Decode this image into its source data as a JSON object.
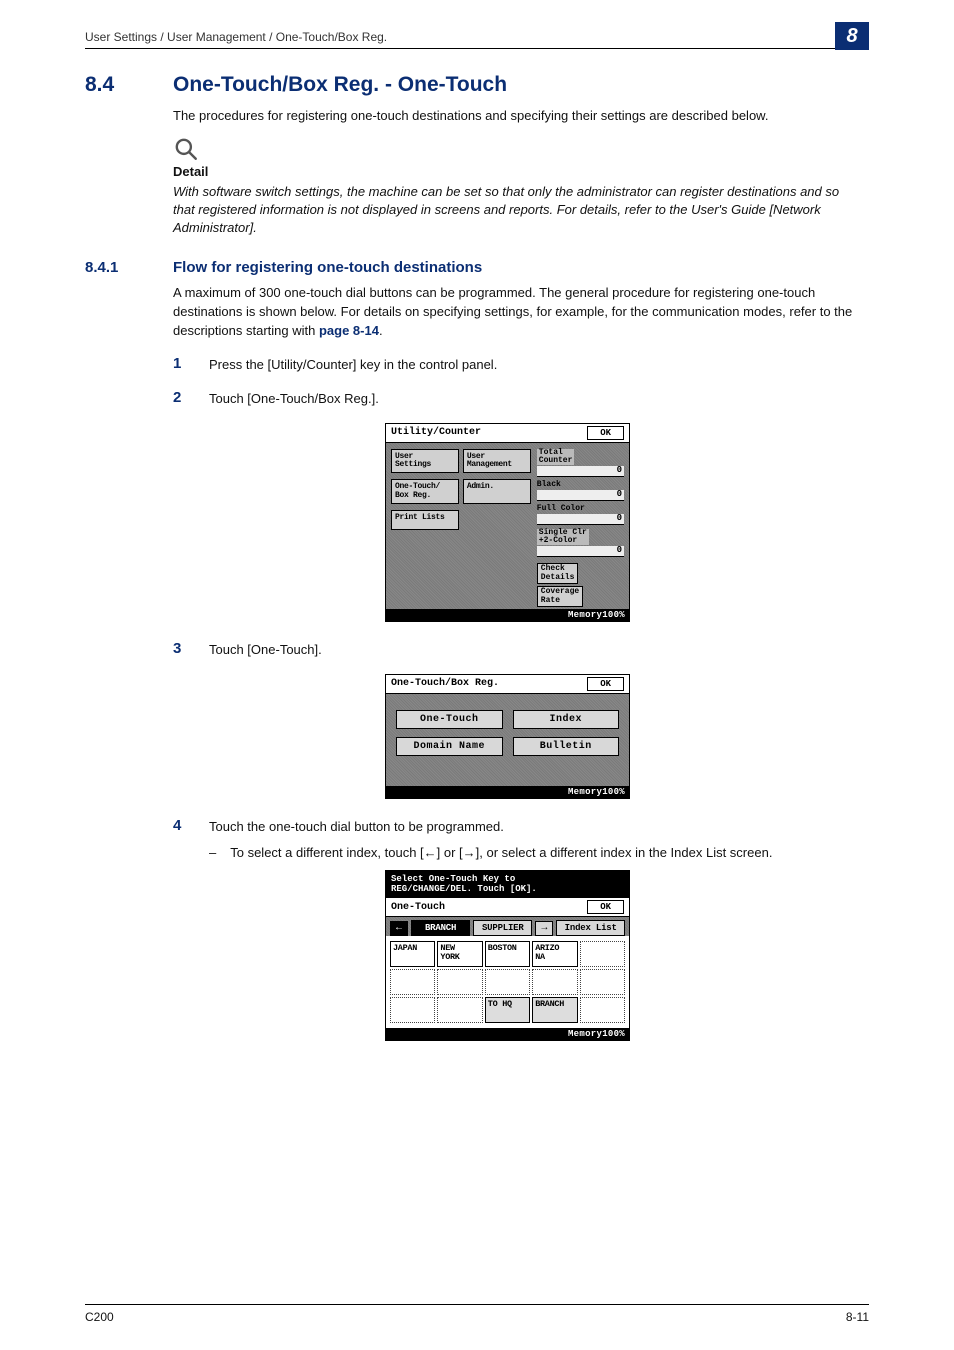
{
  "header": {
    "breadcrumb": "User Settings / User Management / One-Touch/Box Reg.",
    "chapter": "8"
  },
  "section": {
    "number": "8.4",
    "title": "One-Touch/Box Reg. - One-Touch",
    "intro": "The procedures for registering one-touch destinations and specifying their settings are described below."
  },
  "detail": {
    "label": "Detail",
    "body": "With software switch settings, the machine can be set so that only the administrator can register destinations and so that registered information is not displayed in screens and reports. For details, refer to the User's Guide [Network Administrator]."
  },
  "subsection": {
    "number": "8.4.1",
    "title": "Flow for registering one-touch destinations",
    "intro_a": "A maximum of 300 one-touch dial buttons can be programmed. The general procedure for registering one-touch destinations is shown below. For details on specifying settings, for example, for the communication modes, refer to the descriptions starting with ",
    "page_ref": "page 8-14",
    "intro_b": "."
  },
  "steps": {
    "s1": {
      "num": "1",
      "text": "Press the [Utility/Counter] key in the control panel."
    },
    "s2": {
      "num": "2",
      "text": "Touch [One-Touch/Box Reg.]."
    },
    "s3": {
      "num": "3",
      "text": "Touch [One-Touch]."
    },
    "s4": {
      "num": "4",
      "text": "Touch the one-touch dial button to be programmed."
    },
    "s4_sub": "To select a different index, touch [←] or [→], or select a different index in the Index List screen."
  },
  "sc1": {
    "title": "Utility/Counter",
    "ok": "OK",
    "btns": {
      "user_settings": "User\nSettings",
      "user_mgmt": "User\nManagement",
      "one_touch": "One-Touch/\nBox Reg.",
      "admin": "Admin.",
      "print_lists": "Print Lists"
    },
    "right": {
      "total": "Total\nCounter",
      "v_total": "0",
      "black": "Black",
      "v_black": "0",
      "full": "Full Color",
      "v_full": "0",
      "single": "Single Clr\n+2-Color",
      "v_single": "0",
      "check": "Check\nDetails",
      "coverage": "Coverage\nRate"
    },
    "memory": "Memory100%"
  },
  "sc2": {
    "title": "One-Touch/Box Reg.",
    "ok": "OK",
    "btns": {
      "one_touch": "One-Touch",
      "index": "Index",
      "domain": "Domain Name",
      "bulletin": "Bulletin"
    },
    "memory": "Memory100%"
  },
  "sc3": {
    "pre1": "Select One-Touch Key to",
    "pre2": "REG/CHANGE/DEL. Touch [OK].",
    "title": "One-Touch",
    "ok": "OK",
    "tabs": {
      "left_arrow": "←",
      "branch": "BRANCH",
      "supplier": "SUPPLIER",
      "right_arrow": "→",
      "index_list": "Index List"
    },
    "cells": {
      "japan": "JAPAN",
      "newyork": "NEW\nYORK",
      "boston": "BOSTON",
      "arizona": "ARIZO\nNA",
      "tohq": "TO HQ",
      "branch": "BRANCH"
    },
    "memory": "Memory100%"
  },
  "footer": {
    "model": "C200",
    "page": "8-11"
  }
}
